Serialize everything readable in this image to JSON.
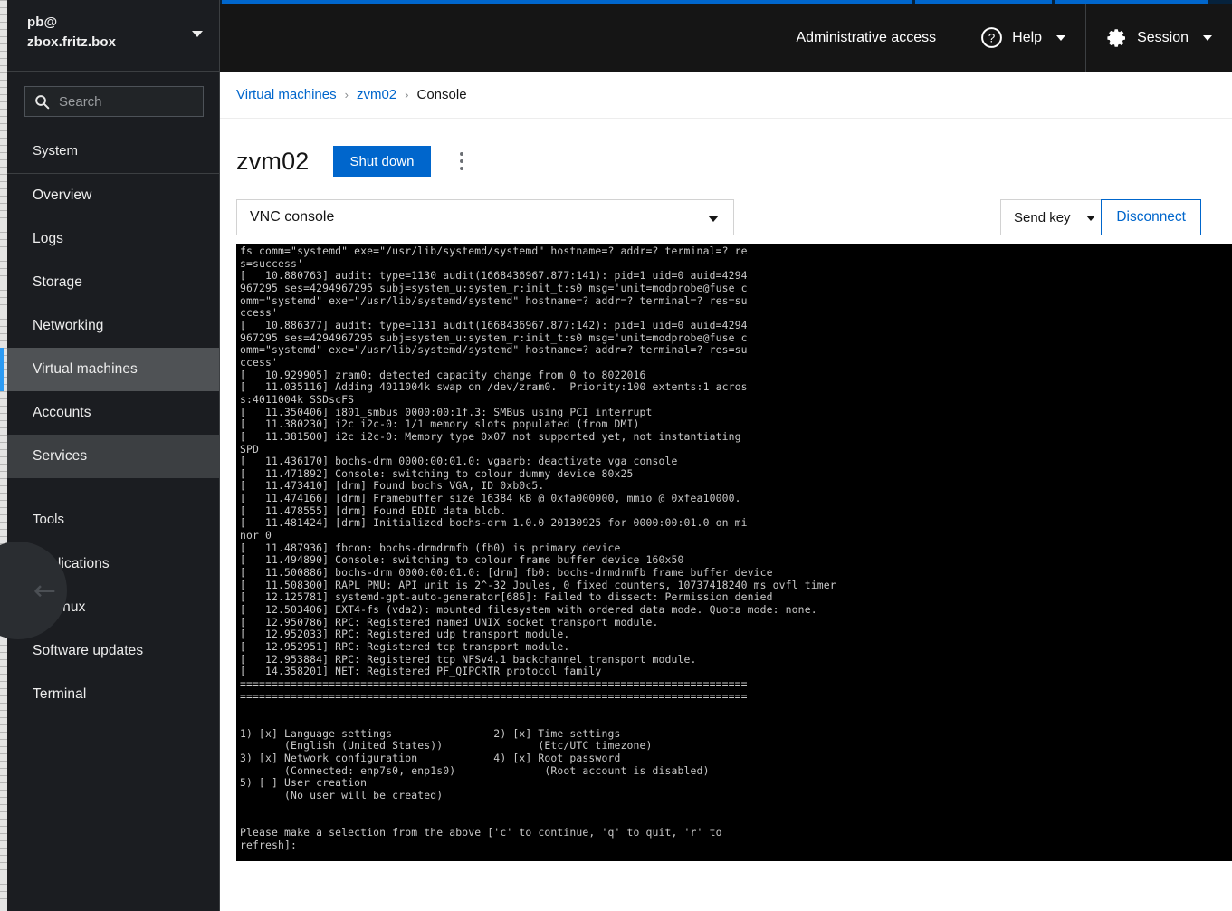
{
  "background_window": {
    "name": "ruler-strip"
  },
  "sidebar": {
    "host": {
      "user_line": "pb@",
      "host_line": "zbox.fritz.box"
    },
    "search": {
      "placeholder": "Search",
      "value": ""
    },
    "sections": [
      {
        "title": "System",
        "items": [
          {
            "label": "Overview",
            "state": "normal"
          },
          {
            "label": "Logs",
            "state": "normal"
          },
          {
            "label": "Storage",
            "state": "normal"
          },
          {
            "label": "Networking",
            "state": "normal"
          },
          {
            "label": "Virtual machines",
            "state": "active"
          },
          {
            "label": "Accounts",
            "state": "normal"
          },
          {
            "label": "Services",
            "state": "hover"
          }
        ]
      },
      {
        "title": "Tools",
        "items": [
          {
            "label": "Applications",
            "state": "normal"
          },
          {
            "label": "SELinux",
            "state": "normal"
          },
          {
            "label": "Software updates",
            "state": "normal"
          },
          {
            "label": "Terminal",
            "state": "normal"
          }
        ]
      }
    ]
  },
  "topbar": {
    "accent_color": "#0066cc",
    "admin_access": "Administrative access",
    "help": "Help",
    "session": "Session"
  },
  "breadcrumb": {
    "items": [
      {
        "label": "Virtual machines",
        "link": true
      },
      {
        "label": "zvm02",
        "link": true
      },
      {
        "label": "Console",
        "link": false
      }
    ],
    "separator": "›"
  },
  "page": {
    "title": "zvm02",
    "shutdown_label": "Shut down",
    "kebab_label": "More actions"
  },
  "console_toolbar": {
    "console_type": "VNC console",
    "send_key": "Send key",
    "disconnect": "Disconnect"
  },
  "vnc_console": {
    "text": "fs comm=\"systemd\" exe=\"/usr/lib/systemd/systemd\" hostname=? addr=? terminal=? re\ns=success'\n[   10.880763] audit: type=1130 audit(1668436967.877:141): pid=1 uid=0 auid=4294\n967295 ses=4294967295 subj=system_u:system_r:init_t:s0 msg='unit=modprobe@fuse c\nomm=\"systemd\" exe=\"/usr/lib/systemd/systemd\" hostname=? addr=? terminal=? res=su\nccess'\n[   10.886377] audit: type=1131 audit(1668436967.877:142): pid=1 uid=0 auid=4294\n967295 ses=4294967295 subj=system_u:system_r:init_t:s0 msg='unit=modprobe@fuse c\nomm=\"systemd\" exe=\"/usr/lib/systemd/systemd\" hostname=? addr=? terminal=? res=su\nccess'\n[   10.929905] zram0: detected capacity change from 0 to 8022016\n[   11.035116] Adding 4011004k swap on /dev/zram0.  Priority:100 extents:1 acros\ns:4011004k SSDscFS\n[   11.350406] i801_smbus 0000:00:1f.3: SMBus using PCI interrupt\n[   11.380230] i2c i2c-0: 1/1 memory slots populated (from DMI)\n[   11.381500] i2c i2c-0: Memory type 0x07 not supported yet, not instantiating\nSPD\n[   11.436170] bochs-drm 0000:00:01.0: vgaarb: deactivate vga console\n[   11.471892] Console: switching to colour dummy device 80x25\n[   11.473410] [drm] Found bochs VGA, ID 0xb0c5.\n[   11.474166] [drm] Framebuffer size 16384 kB @ 0xfa000000, mmio @ 0xfea10000.\n[   11.478555] [drm] Found EDID data blob.\n[   11.481424] [drm] Initialized bochs-drm 1.0.0 20130925 for 0000:00:01.0 on mi\nnor 0\n[   11.487936] fbcon: bochs-drmdrmfb (fb0) is primary device\n[   11.494890] Console: switching to colour frame buffer device 160x50\n[   11.500886] bochs-drm 0000:00:01.0: [drm] fb0: bochs-drmdrmfb frame buffer device\n[   11.508300] RAPL PMU: API unit is 2^-32 Joules, 0 fixed counters, 10737418240 ms ovfl timer\n[   12.125781] systemd-gpt-auto-generator[686]: Failed to dissect: Permission denied\n[   12.503406] EXT4-fs (vda2): mounted filesystem with ordered data mode. Quota mode: none.\n[   12.950786] RPC: Registered named UNIX socket transport module.\n[   12.952033] RPC: Registered udp transport module.\n[   12.952951] RPC: Registered tcp transport module.\n[   12.953884] RPC: Registered tcp NFSv4.1 backchannel transport module.\n[   14.358201] NET: Registered PF_QIPCRTR protocol family\n================================================================================\n================================================================================\n\n\n1) [x] Language settings                2) [x] Time settings\n       (English (United States))               (Etc/UTC timezone)\n3) [x] Network configuration            4) [x] Root password\n       (Connected: enp7s0, enp1s0)              (Root account is disabled)\n5) [ ] User creation\n       (No user will be created)\n\n\nPlease make a selection from the above ['c' to continue, 'q' to quit, 'r' to\nrefresh]:"
  }
}
